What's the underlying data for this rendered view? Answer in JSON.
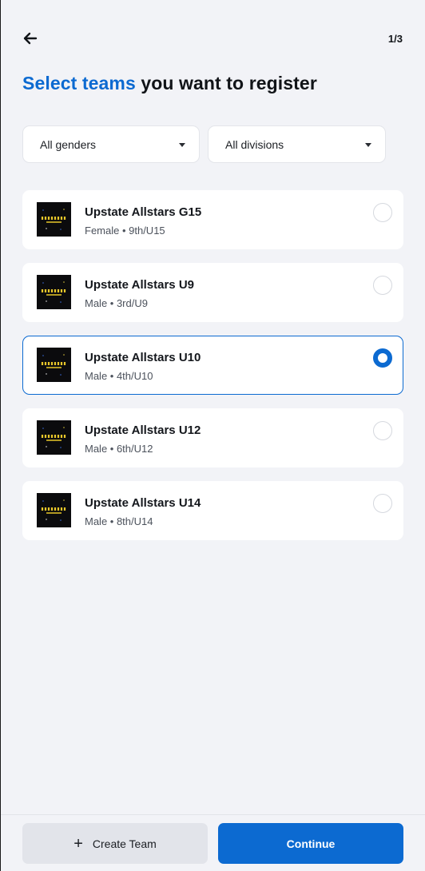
{
  "header": {
    "back_icon": "arrow-left-icon",
    "step": "1/3"
  },
  "title": {
    "accent": "Select teams",
    "rest": " you want to register"
  },
  "filters": {
    "gender": "All genders",
    "division": "All divisions"
  },
  "teams": [
    {
      "name": "Upstate Allstars G15",
      "sub": "Female • 9th/U15",
      "selected": false
    },
    {
      "name": "Upstate Allstars U9",
      "sub": "Male • 3rd/U9",
      "selected": false
    },
    {
      "name": "Upstate Allstars U10",
      "sub": "Male • 4th/U10",
      "selected": true
    },
    {
      "name": "Upstate Allstars U12",
      "sub": "Male • 6th/U12",
      "selected": false
    },
    {
      "name": "Upstate Allstars U14",
      "sub": "Male • 8th/U14",
      "selected": false
    }
  ],
  "footer": {
    "create_label": "Create Team",
    "continue_label": "Continue"
  },
  "colors": {
    "accent": "#0c6ad1",
    "background": "#f2f3f7"
  }
}
